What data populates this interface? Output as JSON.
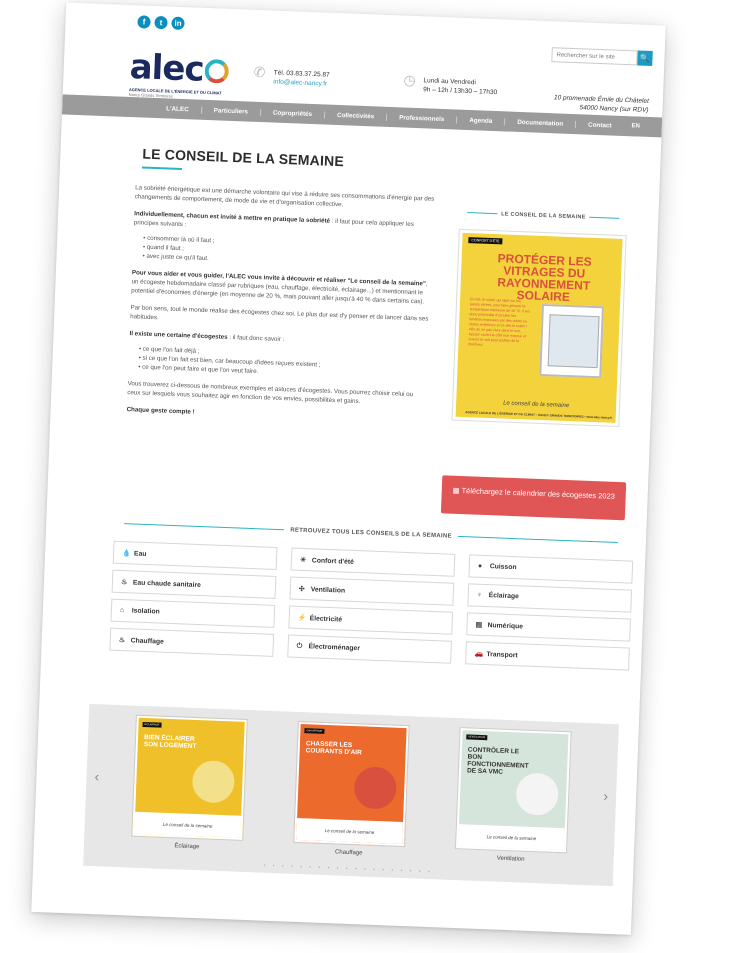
{
  "header": {
    "social": [
      "f",
      "t",
      "in"
    ],
    "search_placeholder": "Rechercher sur le site",
    "search_button": "🔍",
    "logo_word": "alec",
    "logo_tagline": "AGENCE LOCALE DE L'ÉNERGIE ET DU CLIMAT",
    "logo_sub": "Nancy Grands Territoires",
    "phone": "Tél. 03.83.37.25.87",
    "email": "info@alec-nancy.fr",
    "hours_days": "Lundi au Vendredi",
    "hours_time": "9h – 12h / 13h30 – 17h30",
    "address_1": "10 promenade Émile du Châtelet",
    "address_2": "54000 Nancy (sur RDV)"
  },
  "nav": {
    "items": [
      "L'ALEC",
      "Particuliers",
      "Copropriétés",
      "Collectivités",
      "Professionnels",
      "Agenda",
      "Documentation",
      "Contact"
    ],
    "lang": "EN"
  },
  "page": {
    "title": "LE CONSEIL DE LA SEMAINE",
    "p1": "La sobriété énergétique est une démarche volontaire qui vise à réduire ses consommations d'énergie par des changements de comportement, de mode de vie et d'organisation collective.",
    "p2_bold": "Individuellement, chacun est invité à mettre en pratique la sobriété",
    "p2_rest": " : il faut pour cela appliquer les principes suivants :",
    "list1": [
      "consommer là où il faut ;",
      "quand il faut ;",
      "avec juste ce qu'il faut."
    ],
    "p3_bold": "Pour vous aider et vous guider, l'ALEC vous invite à découvrir et réaliser \"Le conseil de la semaine\"",
    "p3_rest": ", un écogeste hebdomadaire classé par rubriques (eau, chauffage, électricité, éclairage...) et mentionnant le potentiel d'économies d'énergie (en moyenne de 20 %, mais pouvant aller jusqu'à 40 % dans certains cas).",
    "p4": "Par bon sens, tout le monde réalise des écogestes chez soi. Le plus dur est d'y penser et de lancer dans ses habitudes.",
    "p5_bold": "Il existe une certaine d'écogestes",
    "p5_rest": " : il faut donc savoir :",
    "list2": [
      "ce que l'on fait déjà ;",
      "si ce que l'on fait est bien, car beaucoup d'idées reçues existent ;",
      "ce que l'on peut faire et que l'on veut faire."
    ],
    "p6": "Vous trouverez ci-dessous de nombreux exemples et astuces d'écogestes. Vous pourrez choisir celui ou ceux sur lesquels vous souhaitez agir en fonction de vos envies, possibilités et gains.",
    "p7": "Chaque geste compte !"
  },
  "sidebar": {
    "title": "LE CONSEIL DE LA SEMAINE",
    "poster_badge": "CONFORT D'ÉTÉ",
    "poster_title": "PROTÉGER LES VITRAGES DU RAYONNEMENT SOLAIRE",
    "poster_text": "En été, le soleil, qui tape sur les parois vitrées, peut faire grimper la température intérieure de 10 °C. Il est donc primordial d'occulter les fenêtres exposées par des volets ou stores extérieurs et ce dès le matin ! Afin de ne pas vivre dans le noir, laissez ouvert le côté non exposé et ouvrez le soir pour profiter de la fraîcheur.",
    "poster_signature": "Le conseil de la semaine",
    "poster_footer": "AGENCE LOCALE DE L'ÉNERGIE ET DU CLIMAT – NANCY GRANDS TERRITOIRES • www.alec-nancy.fr",
    "download_label": "Téléchargez le calendrier des écogestes 2023"
  },
  "categories": {
    "title": "RETROUVEZ TOUS LES CONSEILS DE LA SEMAINE",
    "items": [
      {
        "label": "Eau",
        "icon": "💧"
      },
      {
        "label": "Confort d'été",
        "icon": "☀"
      },
      {
        "label": "Cuisson",
        "icon": "●"
      },
      {
        "label": "Eau chaude sanitaire",
        "icon": "♨"
      },
      {
        "label": "Ventilation",
        "icon": "✣"
      },
      {
        "label": "Éclairage",
        "icon": "♀"
      },
      {
        "label": "Isolation",
        "icon": "⌂"
      },
      {
        "label": "Électricité",
        "icon": "⚡"
      },
      {
        "label": "Numérique",
        "icon": "▤"
      },
      {
        "label": "Chauffage",
        "icon": "♨"
      },
      {
        "label": "Électroménager",
        "icon": "⏻"
      },
      {
        "label": "Transport",
        "icon": "🚗"
      }
    ]
  },
  "carousel": {
    "cards": [
      {
        "badge": "ÉCLAIRAGE",
        "title": "BIEN ÉCLAIRER SON LOGEMENT",
        "caption": "Éclairage",
        "bg": "#f0c02b",
        "pic": "#f3e08a"
      },
      {
        "badge": "CHAUFFAGE",
        "title": "CHASSER LES COURANTS D'AIR",
        "caption": "Chauffage",
        "bg": "#ec6a2c",
        "pic": "#d9503f"
      },
      {
        "badge": "VENTILATION",
        "title": "CONTRÔLER LE BON FONCTIONNEMENT DE SA VMC",
        "caption": "Ventilation",
        "bg": "#d6e5dc",
        "pic": "#f4f4f4"
      }
    ],
    "signature": "Le conseil de la semaine",
    "dots": "• • • • • • • • • • • • • • • • • • •"
  }
}
